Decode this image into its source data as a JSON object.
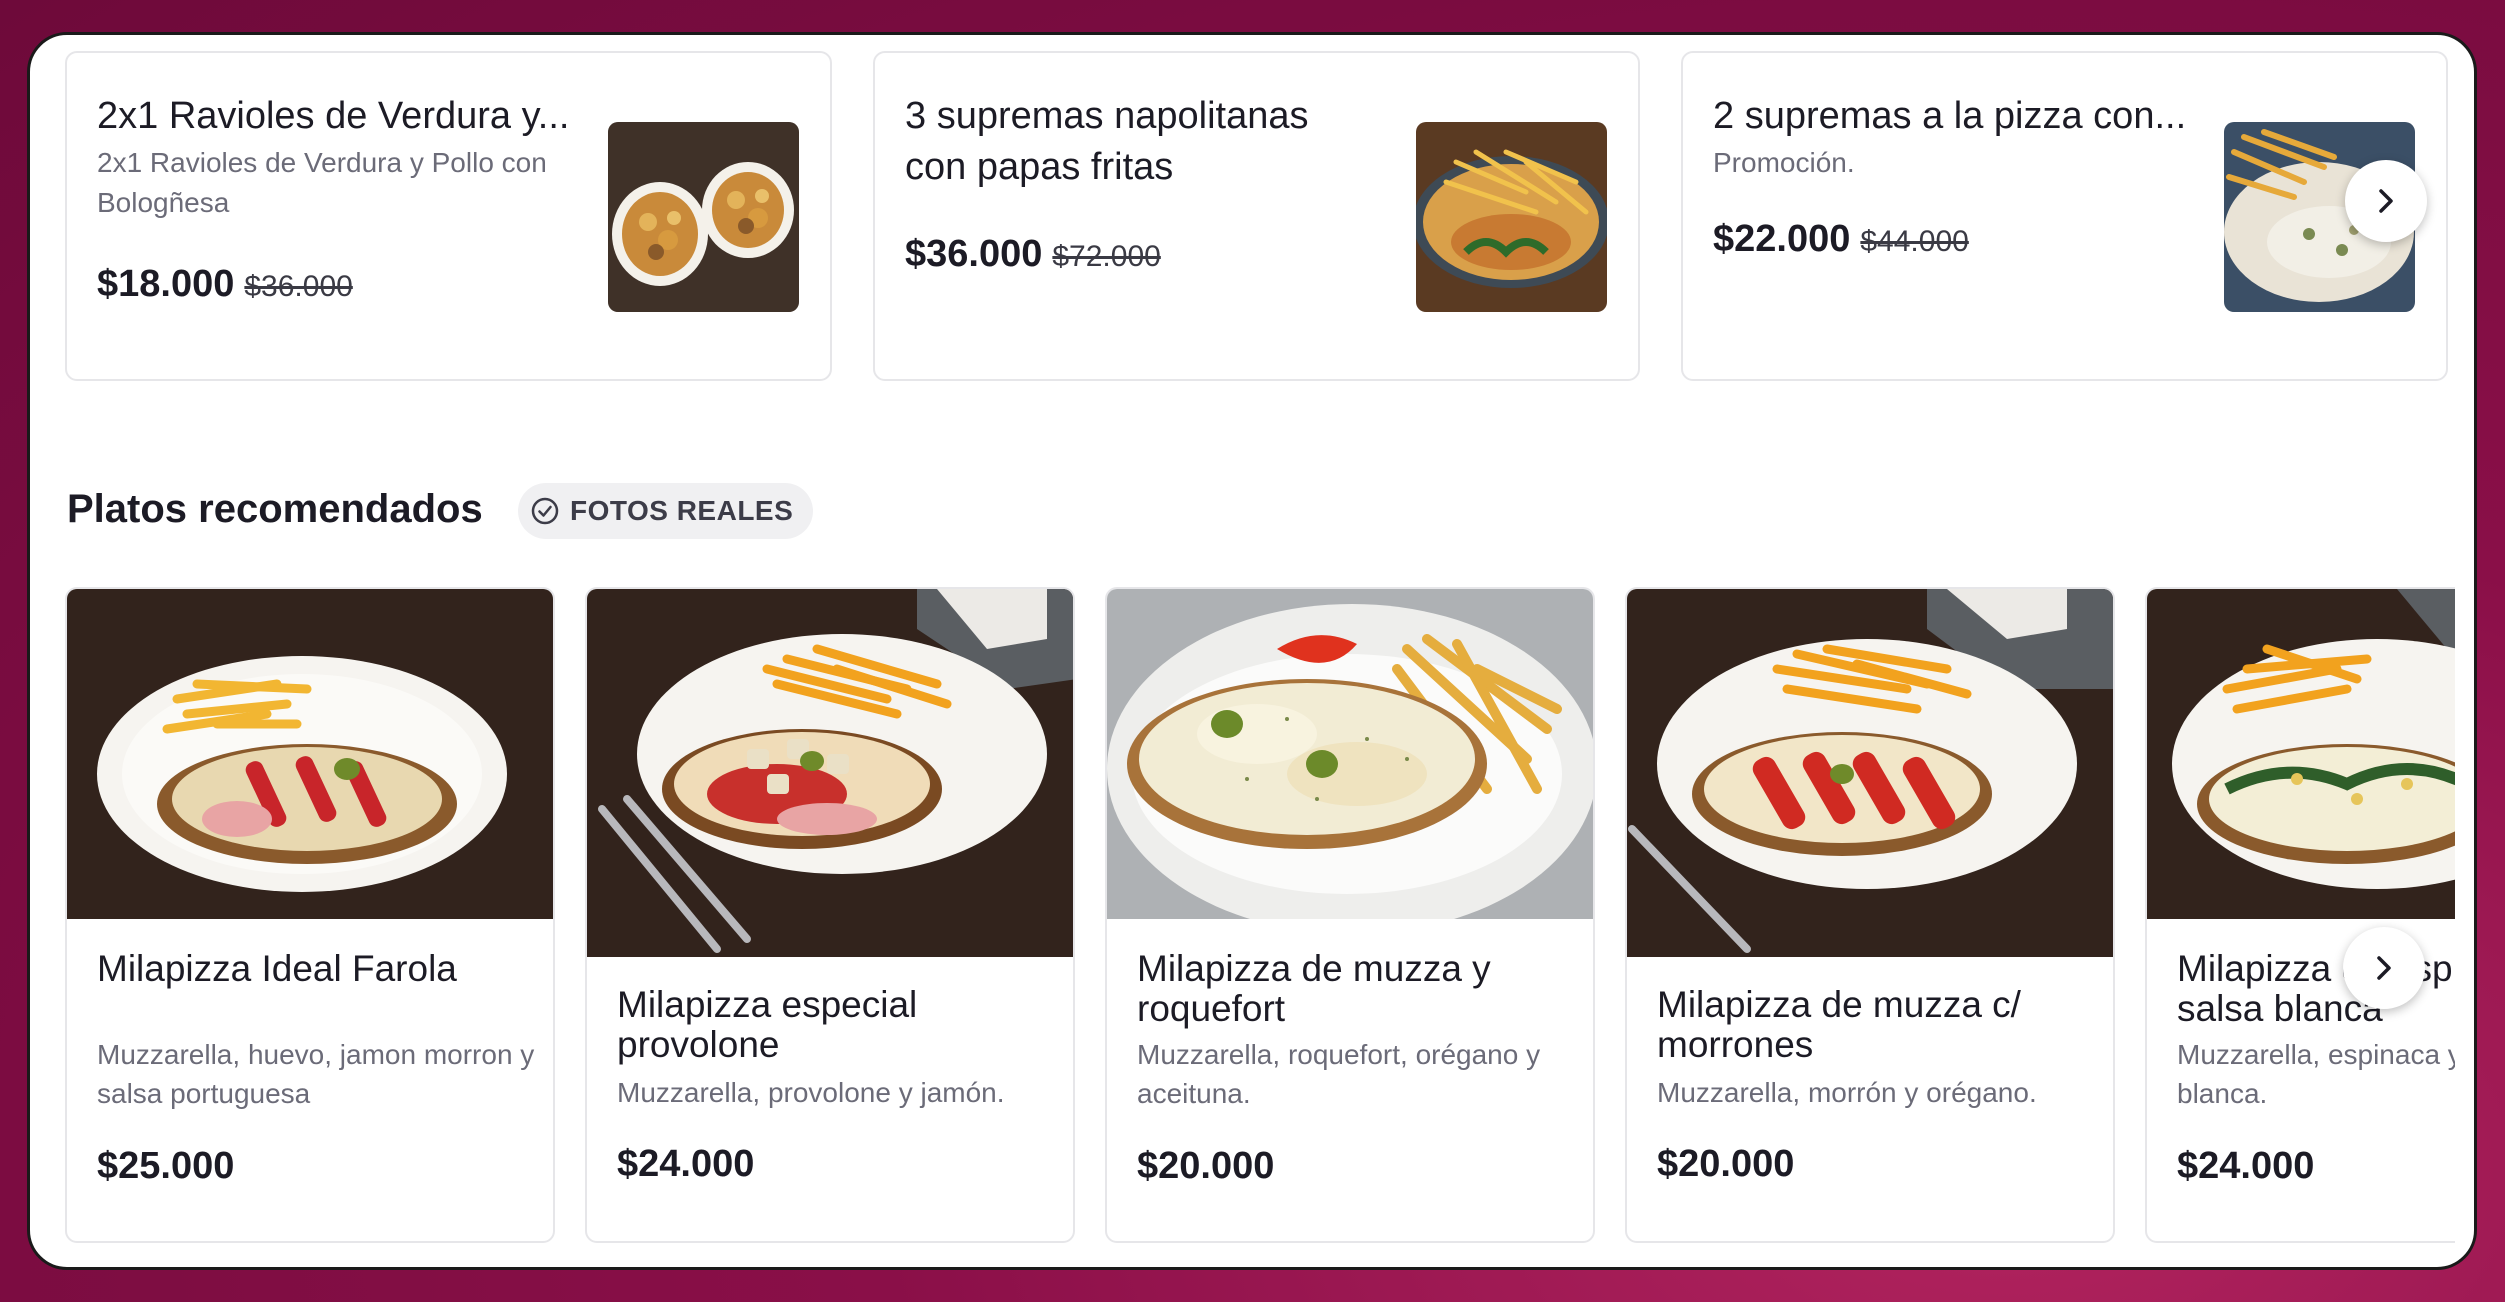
{
  "promotions": [
    {
      "title": "2x1 Ravioles de Verdura y...",
      "description": "2x1 Ravioles de Verdura y Pollo con Bologñesa",
      "price": "$18.000",
      "old_price": "$36.000"
    },
    {
      "title": "3 supremas napolitanas con papas fritas",
      "description": "",
      "price": "$36.000",
      "old_price": "$72.000"
    },
    {
      "title": "2 supremas a la pizza con...",
      "description": "Promoción.",
      "price": "$22.000",
      "old_price": "$44.000"
    }
  ],
  "recommended": {
    "title": "Platos recomendados",
    "badge": "FOTOS REALES",
    "dishes": [
      {
        "name": "Milapizza Ideal Farola",
        "description": "Muzzarella, huevo, jamon morron y salsa portuguesa",
        "price": "$25.000"
      },
      {
        "name": "Milapizza especial provolone",
        "description": "Muzzarella, provolone y jamón.",
        "price": "$24.000"
      },
      {
        "name": "Milapizza de muzza y roquefort",
        "description": "Muzzarella, roquefort, orégano y aceituna.",
        "price": "$20.000"
      },
      {
        "name": "Milapizza de muzza c/ morrones",
        "description": "Muzzarella, morrón y orégano.",
        "price": "$20.000"
      },
      {
        "name": "Milapizza de espinaca c/ salsa blanca",
        "description": "Muzzarella, espinaca y salsa blanca.",
        "price": "$24.000"
      }
    ]
  },
  "icons": {
    "next": "chevron-right-icon",
    "badge": "check-circle-icon"
  },
  "colors": {
    "text": "#1c1b25",
    "muted": "#6b6b78",
    "border": "#e6e6e9",
    "background": "#8a0f48"
  }
}
